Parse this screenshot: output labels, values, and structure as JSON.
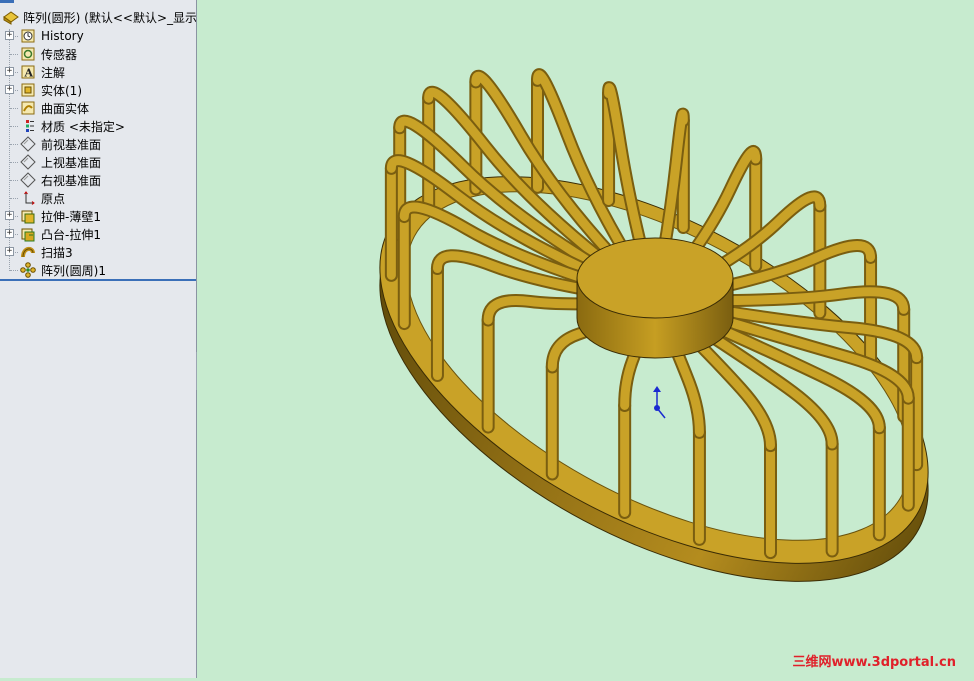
{
  "tree": {
    "root_label": "阵列(圆形) (默认<<默认>_显示",
    "items": [
      {
        "label": "History",
        "icon": "history-icon",
        "expandable": true
      },
      {
        "label": "传感器",
        "icon": "sensor-icon",
        "expandable": false
      },
      {
        "label": "注解",
        "icon": "annotation-icon",
        "expandable": true
      },
      {
        "label": "实体(1)",
        "icon": "solid-bodies-icon",
        "expandable": true
      },
      {
        "label": "曲面实体",
        "icon": "surface-bodies-icon",
        "expandable": false
      },
      {
        "label": "材质 <未指定>",
        "icon": "material-icon",
        "expandable": false
      },
      {
        "label": "前视基准面",
        "icon": "plane-icon",
        "expandable": false
      },
      {
        "label": "上视基准面",
        "icon": "plane-icon",
        "expandable": false
      },
      {
        "label": "右视基准面",
        "icon": "plane-icon",
        "expandable": false
      },
      {
        "label": "原点",
        "icon": "origin-icon",
        "expandable": false
      },
      {
        "label": "拉伸-薄壁1",
        "icon": "extrude-thin-icon",
        "expandable": true
      },
      {
        "label": "凸台-拉伸1",
        "icon": "boss-extrude-icon",
        "expandable": true
      },
      {
        "label": "扫描3",
        "icon": "sweep-icon",
        "expandable": true
      },
      {
        "label": "阵列(圆周)1",
        "icon": "circular-pattern-icon",
        "expandable": false
      }
    ]
  },
  "splitter_glyph": "‹‹‹",
  "watermark": "三维网www.3dportal.cn",
  "colors": {
    "viewport_bg": "#c7ebcf",
    "model_gold": "#c9a227",
    "model_dark": "#7a5e10",
    "watermark": "#e0202a"
  }
}
